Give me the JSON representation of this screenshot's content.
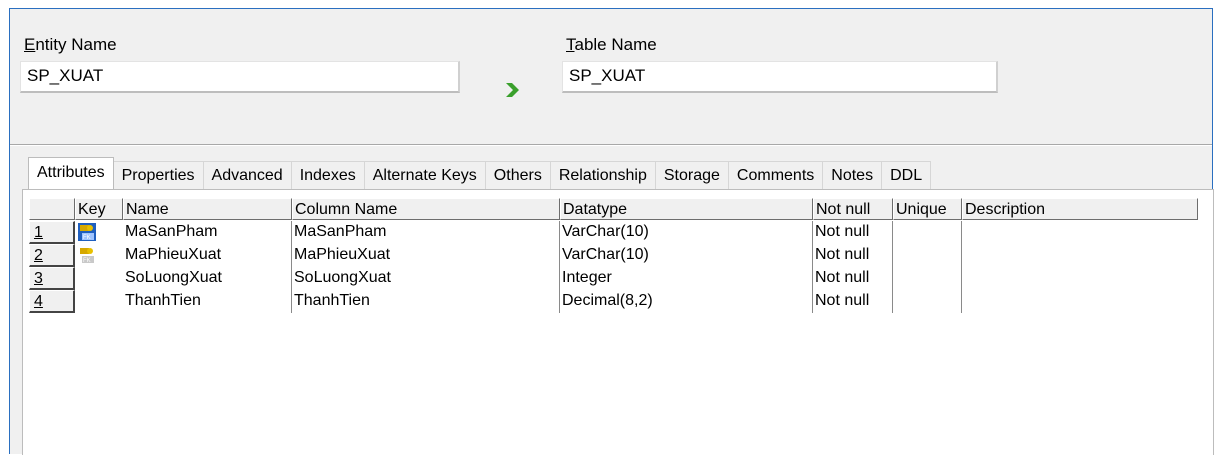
{
  "entity": {
    "label_ul": "E",
    "label_rest": "ntity Name",
    "value": "SP_XUAT"
  },
  "table": {
    "label_ul": "T",
    "label_rest": "able Name",
    "value": "SP_XUAT"
  },
  "tabs": [
    "Attributes",
    "Properties",
    "Advanced",
    "Indexes",
    "Alternate Keys",
    "Others",
    "Relationship",
    "Storage",
    "Comments",
    "Notes",
    "DDL"
  ],
  "active_tab": "Attributes",
  "columns": [
    "Key",
    "Name",
    "Column Name",
    "Datatype",
    "Not null",
    "Unique",
    "Description"
  ],
  "rows": [
    {
      "num": "1",
      "key": "pk-fk-selected-icon",
      "name": "MaSanPham",
      "column_name": "MaSanPham",
      "datatype": "VarChar(10)",
      "not_null": "Not null",
      "unique": "",
      "description": ""
    },
    {
      "num": "2",
      "key": "pk-fk-icon",
      "name": "MaPhieuXuat",
      "column_name": "MaPhieuXuat",
      "datatype": "VarChar(10)",
      "not_null": "Not null",
      "unique": "",
      "description": ""
    },
    {
      "num": "3",
      "key": "",
      "name": "SoLuongXuat",
      "column_name": "SoLuongXuat",
      "datatype": "Integer",
      "not_null": "Not null",
      "unique": "",
      "description": ""
    },
    {
      "num": "4",
      "key": "",
      "name": "ThanhTien",
      "column_name": "ThanhTien",
      "datatype": "Decimal(8,2)",
      "not_null": "Not null",
      "unique": "",
      "description": ""
    }
  ],
  "colors": {
    "frame_border": "#2a6fc0",
    "arrow": "#3aa02c",
    "key_icon": "#d6a800",
    "selection": "#1f5fbf"
  }
}
